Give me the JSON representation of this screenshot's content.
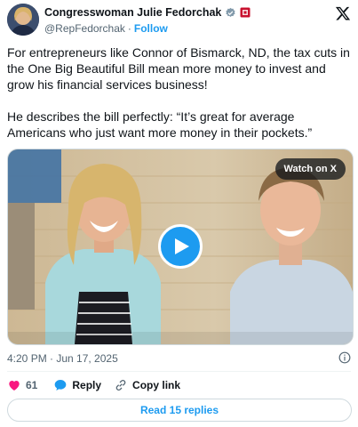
{
  "post": {
    "author": {
      "display_name": "Congresswoman Julie Fedorchak",
      "handle": "@RepFedorchak",
      "separator": "·",
      "follow_label": "Follow"
    },
    "text": {
      "paragraph1": "For entrepreneurs like Connor of Bismarck, ND, the tax cuts in the One Big Beautiful Bill mean more money to invest and grow his financial services business!",
      "paragraph2": "He describes the bill perfectly: “It’s great for average Americans who just want more money in their pockets.”"
    },
    "media": {
      "watch_label": "Watch on X"
    },
    "timestamp": "4:20 PM · Jun 17, 2025",
    "actions": {
      "like_count": "61",
      "reply_label": "Reply",
      "copy_label": "Copy link"
    },
    "read_replies_label": "Read 15 replies"
  },
  "colors": {
    "accent": "#1d9bf0",
    "like": "#f91880",
    "text": "#0f1419",
    "muted": "#536471"
  },
  "icons": [
    "verified-badge-icon",
    "government-badge-icon",
    "x-logo-icon",
    "play-icon",
    "info-icon",
    "heart-icon",
    "reply-bubble-icon",
    "link-icon"
  ]
}
